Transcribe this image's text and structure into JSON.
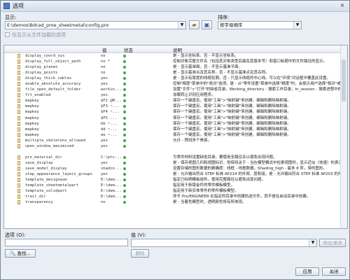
{
  "window": {
    "title": "选项",
    "close_label": "×"
  },
  "display": {
    "label": "显示:",
    "path": "E:\\demos\\Bdcad_proe_sheetmetal\\config.pro"
  },
  "sort": {
    "label": "排序:",
    "value": "按字母顺序"
  },
  "checkbox_label": "仅显示从文件加载的选项",
  "table": {
    "columns": [
      "值",
      "状态",
      "说明"
    ],
    "rows": [
      {
        "name": "display_coord_sys",
        "value": "no",
        "desc": "是 - 显示坐标系。否 - 不显示坐标系。"
      },
      {
        "name": "display_full_object_path",
        "value": "no *",
        "desc": "控制对象完整文件名（包括其对象类型后缀及其版本号）和窗口标题中的文件路径的显示。"
      },
      {
        "name": "display_planes",
        "value": "no",
        "desc": "是 - 显示基准面。否 - 不显示基准平面。"
      },
      {
        "name": "display_points",
        "value": "no",
        "desc": "是 - 显示基准点及其名称。否 - 不显示基准点及其名称。"
      },
      {
        "name": "display_thick_cables",
        "value": "yes",
        "desc": "是 - 显示有厚度的线缆轮廓。否 - 只显示线缆的中心线。可以在\"环境\"对话框中覆盖此设置。"
      },
      {
        "name": "enable_absolute_accuracy",
        "value": "yes",
        "desc": "控制\"精度\"菜单中的\"绝对\"选项。是 - 从\"零件设置\"菜单中选择\"精度\"时，会提示用户选择\"相对\"或\"绝对\"精度。"
      },
      {
        "name": "file_open_default_folder",
        "value": "workin...",
        "desc": "设置\"文件\">\"打开\"的缺省目录。Working_directory - 搜索工作目录；In_session - 搜索进程中的内容。"
      },
      {
        "name": "frt_enabled",
        "value": "yes",
        "desc": "加载转让识别应用程序。"
      },
      {
        "name": "mapkey",
        "value": "$F2 @M...",
        "desc": "保存一个键盘宏。使用\"工具\">\"映射键\"来创建、编辑和删除映射键。"
      },
      {
        "name": "mapkey",
        "value": "$F3 ~...",
        "desc": "保存一个键盘宏。使用\"工具\">\"映射键\"来创建、编辑和删除映射键。"
      },
      {
        "name": "mapkey",
        "value": "$F4 ~...",
        "desc": "保存一个键盘宏。使用\"工具\">\"映射键\"来创建、编辑和删除映射键。"
      },
      {
        "name": "mapkey",
        "value": "$F5 ...",
        "desc": "保存一个键盘宏。使用\"工具\">\"映射键\"来创建、编辑和删除映射键。"
      },
      {
        "name": "mapkey",
        "value": "bb ~...",
        "desc": "保存一个键盘宏。使用\"工具\">\"映射键\"来创建、编辑和删除映射键。"
      },
      {
        "name": "mapkey",
        "value": "dd ~...",
        "desc": "保存一个键盘宏。使用\"工具\">\"映射键\"来创建、编辑和删除映射键。"
      },
      {
        "name": "mapkey",
        "value": "ee ~...",
        "desc": "保存一个键盘宏。使用\"工具\">\"映射键\"来创建、编辑和删除映射键。"
      },
      {
        "name": "multiple_skeletons_allowed",
        "value": "yes",
        "desc": "允许 - 预测多个骨架。"
      },
      {
        "name": "open_window_maximized",
        "value": "yes",
        "desc": ""
      },
      {
        "name": "pro_material_dir",
        "value": "C:\\ptc...",
        "desc": "为零件材料设置缺省目录。要使用全路径名以避免出现问题。"
      },
      {
        "name": "save_display",
        "value": "yes",
        "desc": "是 - 保存视图几何和视图标识，但保持关于 - 当在模型模式中检索视图时，显示近似（快速）的表示。"
      },
      {
        "name": "save_model_display",
        "value": "shadin...",
        "desc": "设置存储的图形数据的精确度：线框 - 线框数据。Shading_high - 最多 8 阶。带的图形。"
      },
      {
        "name": "step_appearance_layers_groups",
        "value": "yes",
        "desc": "是 - 允许输出符合 STEP 标准 AP214 的外观、层和组。是 - 允许输出符合 STEP 标准 AP203 的外观、层和组。"
      },
      {
        "name": "template_designasm",
        "value": "E:\\dem...",
        "desc": "指定已标明模板组件。使用完整路径以避免出现问题。"
      },
      {
        "name": "template_sheetmetalpart",
        "value": "E:\\dem...",
        "desc": "指定用于新钣金件的零件模板模型。"
      },
      {
        "name": "template_solidpart",
        "value": "E:\\dem...",
        "desc": "指定用于新实体零件的零件模板模型。"
      },
      {
        "name": "trail_dir",
        "value": "E:\\dem...",
        "desc": "命令 Pro/ENGINEER 在指定的目录中创建轨迹文件，而不是在启动目录中创建。"
      },
      {
        "name": "transparency",
        "value": "no",
        "desc": "是 - 当着色模型时，透明颜色将有所体现。"
      }
    ]
  },
  "option": {
    "label": "选项 (O):",
    "value_label": "值 (V):",
    "add_change": "添加/更改",
    "remove": "删除"
  },
  "find_label": "查找...",
  "footer": {
    "apply": "应用",
    "close": "关闭"
  }
}
